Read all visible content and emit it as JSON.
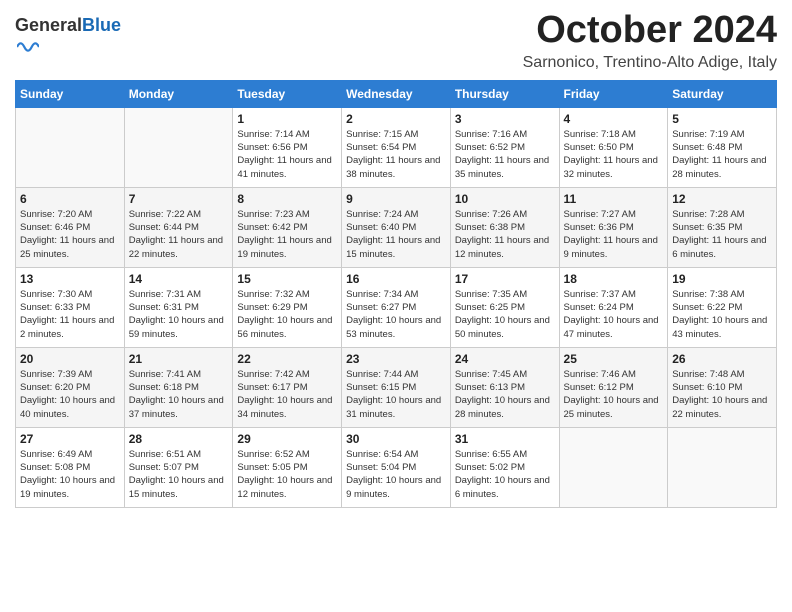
{
  "header": {
    "logo_general": "General",
    "logo_blue": "Blue",
    "month_title": "October 2024",
    "location": "Sarnonico, Trentino-Alto Adige, Italy"
  },
  "days_of_week": [
    "Sunday",
    "Monday",
    "Tuesday",
    "Wednesday",
    "Thursday",
    "Friday",
    "Saturday"
  ],
  "weeks": [
    [
      {
        "day": "",
        "info": ""
      },
      {
        "day": "",
        "info": ""
      },
      {
        "day": "1",
        "info": "Sunrise: 7:14 AM\nSunset: 6:56 PM\nDaylight: 11 hours and 41 minutes."
      },
      {
        "day": "2",
        "info": "Sunrise: 7:15 AM\nSunset: 6:54 PM\nDaylight: 11 hours and 38 minutes."
      },
      {
        "day": "3",
        "info": "Sunrise: 7:16 AM\nSunset: 6:52 PM\nDaylight: 11 hours and 35 minutes."
      },
      {
        "day": "4",
        "info": "Sunrise: 7:18 AM\nSunset: 6:50 PM\nDaylight: 11 hours and 32 minutes."
      },
      {
        "day": "5",
        "info": "Sunrise: 7:19 AM\nSunset: 6:48 PM\nDaylight: 11 hours and 28 minutes."
      }
    ],
    [
      {
        "day": "6",
        "info": "Sunrise: 7:20 AM\nSunset: 6:46 PM\nDaylight: 11 hours and 25 minutes."
      },
      {
        "day": "7",
        "info": "Sunrise: 7:22 AM\nSunset: 6:44 PM\nDaylight: 11 hours and 22 minutes."
      },
      {
        "day": "8",
        "info": "Sunrise: 7:23 AM\nSunset: 6:42 PM\nDaylight: 11 hours and 19 minutes."
      },
      {
        "day": "9",
        "info": "Sunrise: 7:24 AM\nSunset: 6:40 PM\nDaylight: 11 hours and 15 minutes."
      },
      {
        "day": "10",
        "info": "Sunrise: 7:26 AM\nSunset: 6:38 PM\nDaylight: 11 hours and 12 minutes."
      },
      {
        "day": "11",
        "info": "Sunrise: 7:27 AM\nSunset: 6:36 PM\nDaylight: 11 hours and 9 minutes."
      },
      {
        "day": "12",
        "info": "Sunrise: 7:28 AM\nSunset: 6:35 PM\nDaylight: 11 hours and 6 minutes."
      }
    ],
    [
      {
        "day": "13",
        "info": "Sunrise: 7:30 AM\nSunset: 6:33 PM\nDaylight: 11 hours and 2 minutes."
      },
      {
        "day": "14",
        "info": "Sunrise: 7:31 AM\nSunset: 6:31 PM\nDaylight: 10 hours and 59 minutes."
      },
      {
        "day": "15",
        "info": "Sunrise: 7:32 AM\nSunset: 6:29 PM\nDaylight: 10 hours and 56 minutes."
      },
      {
        "day": "16",
        "info": "Sunrise: 7:34 AM\nSunset: 6:27 PM\nDaylight: 10 hours and 53 minutes."
      },
      {
        "day": "17",
        "info": "Sunrise: 7:35 AM\nSunset: 6:25 PM\nDaylight: 10 hours and 50 minutes."
      },
      {
        "day": "18",
        "info": "Sunrise: 7:37 AM\nSunset: 6:24 PM\nDaylight: 10 hours and 47 minutes."
      },
      {
        "day": "19",
        "info": "Sunrise: 7:38 AM\nSunset: 6:22 PM\nDaylight: 10 hours and 43 minutes."
      }
    ],
    [
      {
        "day": "20",
        "info": "Sunrise: 7:39 AM\nSunset: 6:20 PM\nDaylight: 10 hours and 40 minutes."
      },
      {
        "day": "21",
        "info": "Sunrise: 7:41 AM\nSunset: 6:18 PM\nDaylight: 10 hours and 37 minutes."
      },
      {
        "day": "22",
        "info": "Sunrise: 7:42 AM\nSunset: 6:17 PM\nDaylight: 10 hours and 34 minutes."
      },
      {
        "day": "23",
        "info": "Sunrise: 7:44 AM\nSunset: 6:15 PM\nDaylight: 10 hours and 31 minutes."
      },
      {
        "day": "24",
        "info": "Sunrise: 7:45 AM\nSunset: 6:13 PM\nDaylight: 10 hours and 28 minutes."
      },
      {
        "day": "25",
        "info": "Sunrise: 7:46 AM\nSunset: 6:12 PM\nDaylight: 10 hours and 25 minutes."
      },
      {
        "day": "26",
        "info": "Sunrise: 7:48 AM\nSunset: 6:10 PM\nDaylight: 10 hours and 22 minutes."
      }
    ],
    [
      {
        "day": "27",
        "info": "Sunrise: 6:49 AM\nSunset: 5:08 PM\nDaylight: 10 hours and 19 minutes."
      },
      {
        "day": "28",
        "info": "Sunrise: 6:51 AM\nSunset: 5:07 PM\nDaylight: 10 hours and 15 minutes."
      },
      {
        "day": "29",
        "info": "Sunrise: 6:52 AM\nSunset: 5:05 PM\nDaylight: 10 hours and 12 minutes."
      },
      {
        "day": "30",
        "info": "Sunrise: 6:54 AM\nSunset: 5:04 PM\nDaylight: 10 hours and 9 minutes."
      },
      {
        "day": "31",
        "info": "Sunrise: 6:55 AM\nSunset: 5:02 PM\nDaylight: 10 hours and 6 minutes."
      },
      {
        "day": "",
        "info": ""
      },
      {
        "day": "",
        "info": ""
      }
    ]
  ]
}
